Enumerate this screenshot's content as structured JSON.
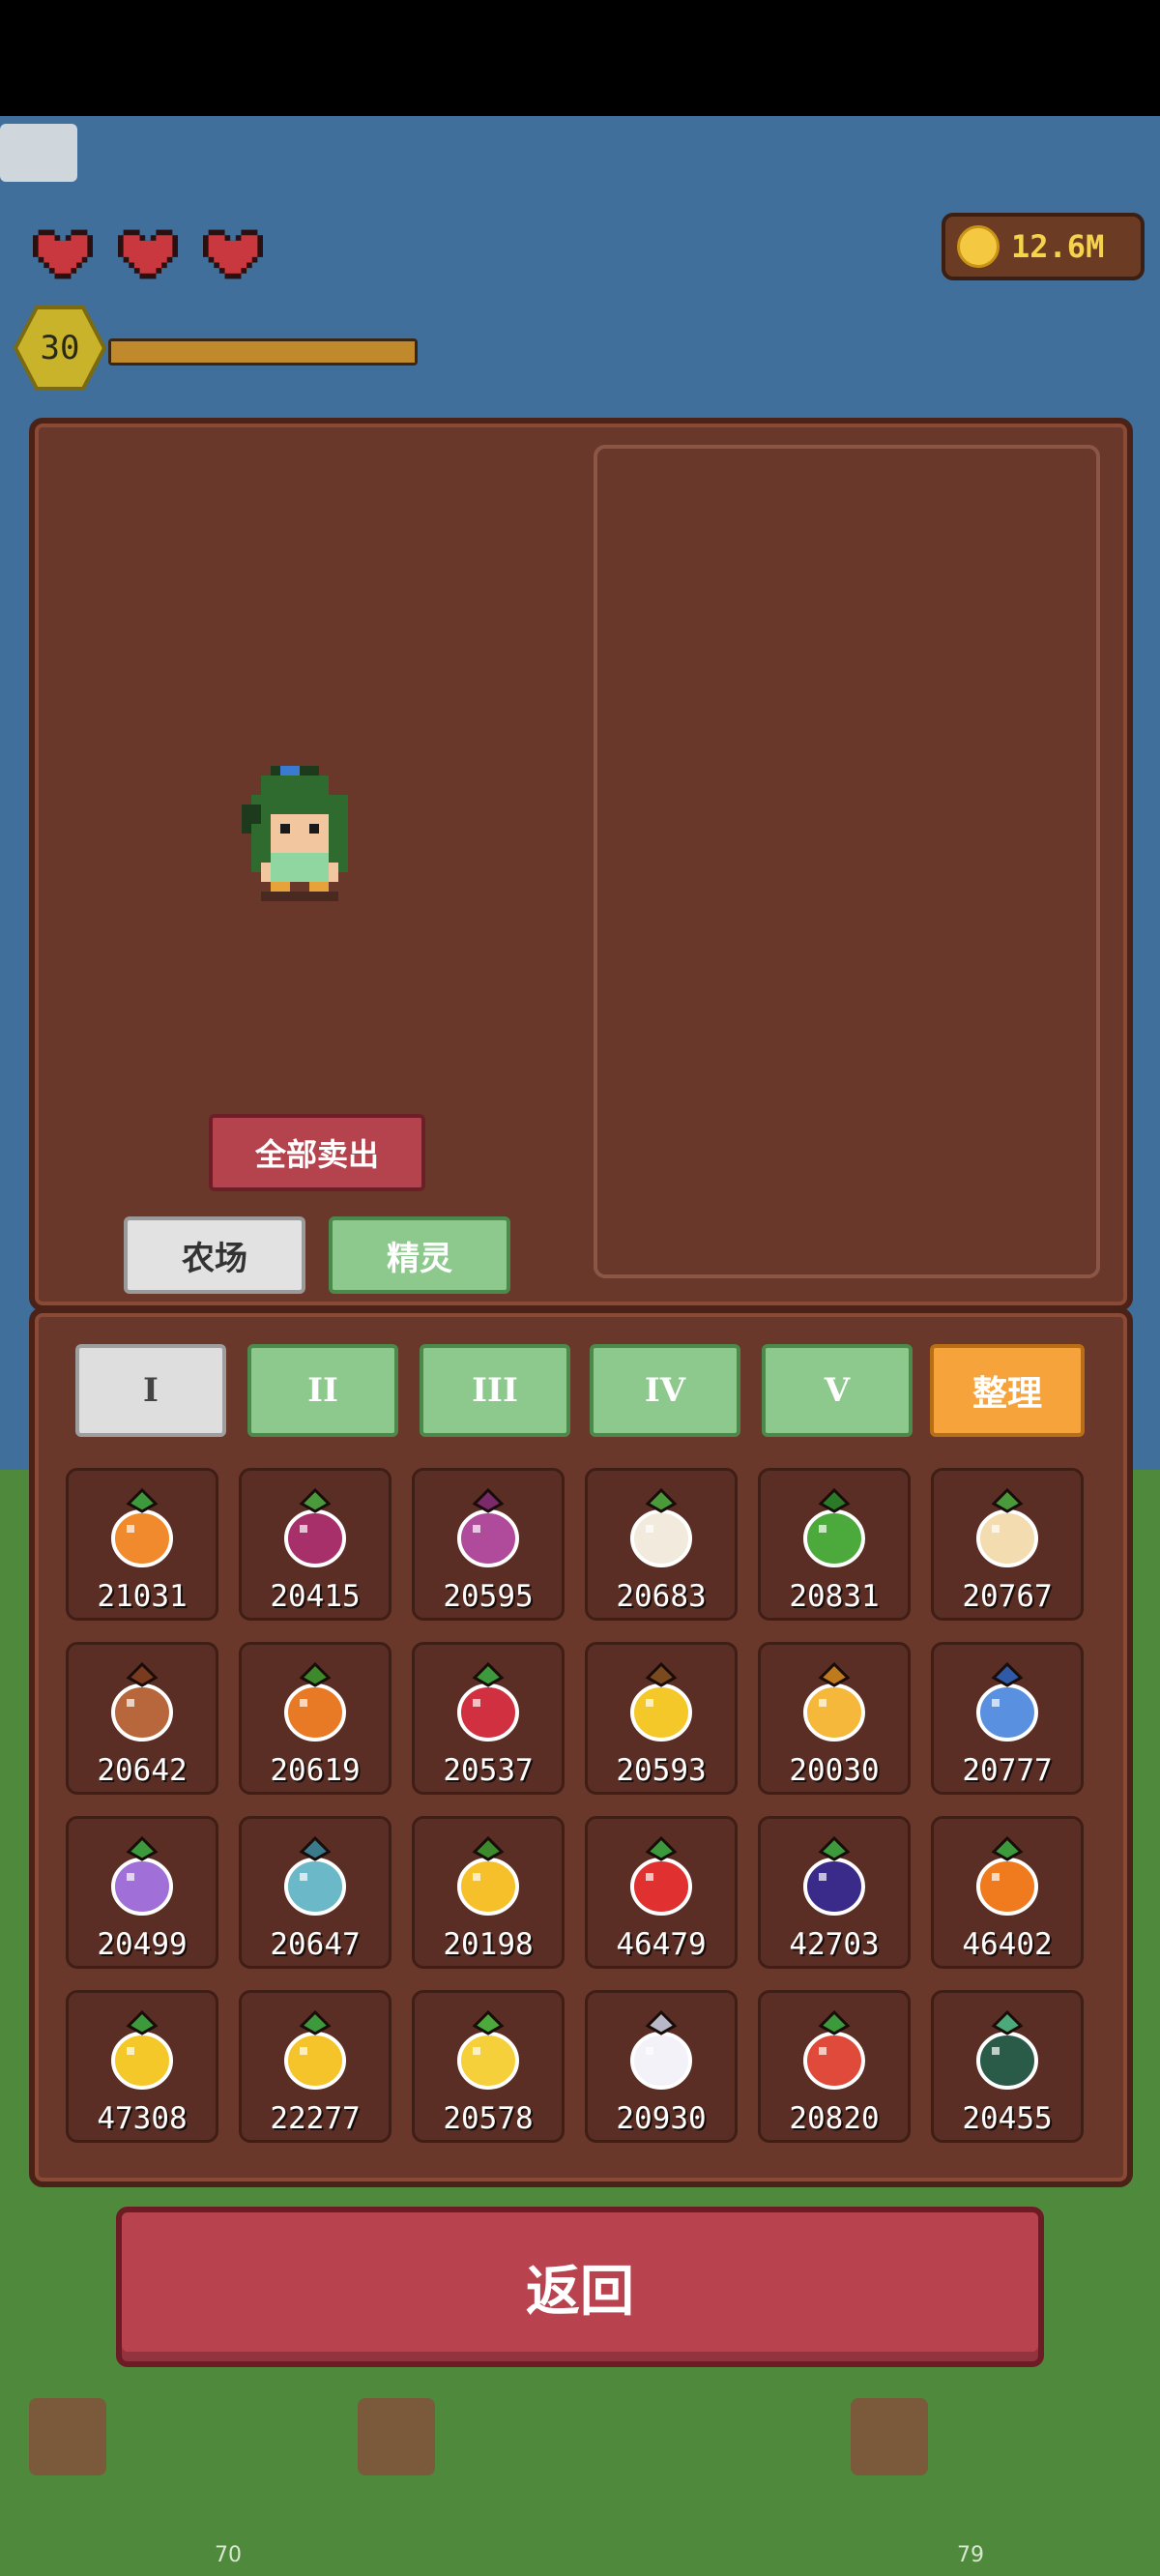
{
  "hud": {
    "hearts": [
      "heart-icon",
      "heart-icon",
      "heart-icon"
    ],
    "level": "30",
    "xp_progress": 1.0,
    "coins": "12.6M"
  },
  "top_panel": {
    "sell_all_label": "全部卖出",
    "tabs": [
      {
        "label": "农场",
        "active": true
      },
      {
        "label": "精灵",
        "active": false
      }
    ]
  },
  "inventory": {
    "tiers": [
      {
        "label": "I",
        "active": true
      },
      {
        "label": "II",
        "active": false
      },
      {
        "label": "III",
        "active": false
      },
      {
        "label": "IV",
        "active": false
      },
      {
        "label": "V",
        "active": false
      }
    ],
    "sort_label": "整理",
    "items": [
      {
        "icon": "carrot-icon",
        "count": "21031"
      },
      {
        "icon": "beet-icon",
        "count": "20415"
      },
      {
        "icon": "purple-flower-icon",
        "count": "20595"
      },
      {
        "icon": "cauliflower-icon",
        "count": "20683"
      },
      {
        "icon": "lettuce-icon",
        "count": "20831"
      },
      {
        "icon": "parsnip-icon",
        "count": "20767"
      },
      {
        "icon": "potato-icon",
        "count": "20642"
      },
      {
        "icon": "pumpkin-icon",
        "count": "20619"
      },
      {
        "icon": "radish-icon",
        "count": "20537"
      },
      {
        "icon": "sunflower-icon",
        "count": "20593"
      },
      {
        "icon": "wheat-icon",
        "count": "20030"
      },
      {
        "icon": "blue-jar-icon",
        "count": "20777"
      },
      {
        "icon": "purple-grape-bunch-icon",
        "count": "20499"
      },
      {
        "icon": "starfruit-icon",
        "count": "20647"
      },
      {
        "icon": "pear-icon",
        "count": "20198"
      },
      {
        "icon": "apple-icon",
        "count": "46479"
      },
      {
        "icon": "grapes-icon",
        "count": "42703"
      },
      {
        "icon": "orange-icon",
        "count": "46402"
      },
      {
        "icon": "pineapple-icon",
        "count": "47308"
      },
      {
        "icon": "mango-icon",
        "count": "22277"
      },
      {
        "icon": "corn-icon",
        "count": "20578"
      },
      {
        "icon": "white-gem-icon",
        "count": "20930"
      },
      {
        "icon": "red-carrot-icon",
        "count": "20820"
      },
      {
        "icon": "melon-icon",
        "count": "20455"
      }
    ]
  },
  "back_label": "返回",
  "background": {
    "plot_numbers": [
      "70",
      "79"
    ]
  },
  "colors": {
    "panel": "#6a372b",
    "sell_button": "#b5434d",
    "tier_inactive": "#8dc98d",
    "sort_button": "#f5a33a",
    "back_button": "#b8434f",
    "coin_text": "#f5d44c"
  }
}
